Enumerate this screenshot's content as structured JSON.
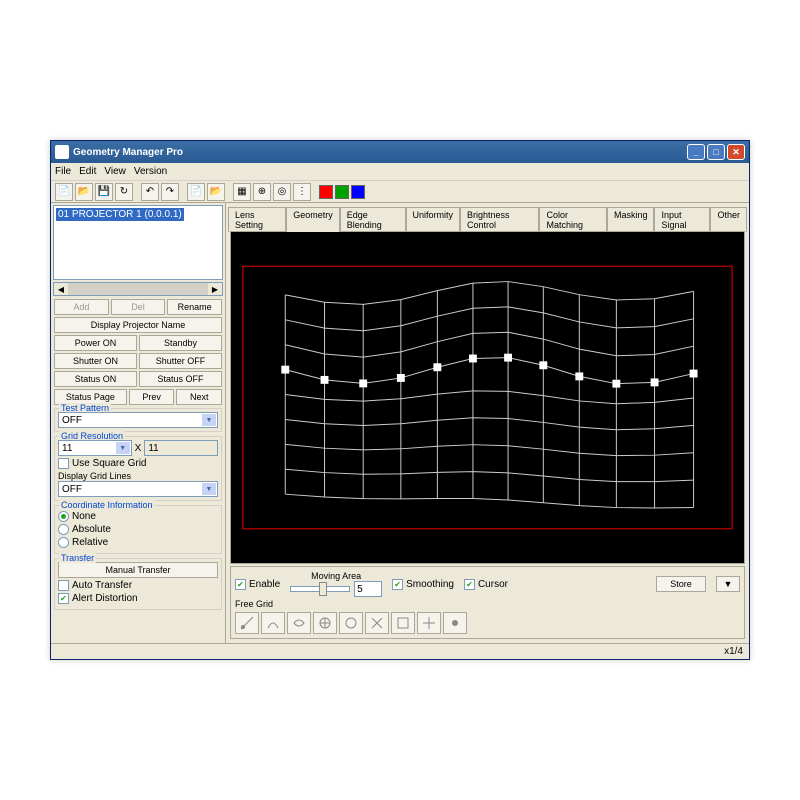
{
  "title": "Geometry Manager Pro",
  "menu": {
    "file": "File",
    "edit": "Edit",
    "view": "View",
    "version": "Version"
  },
  "swatches": [
    "#ff0000",
    "#00a000",
    "#0000ff"
  ],
  "projector": {
    "item": "01   PROJECTOR 1 (0.0.0.1)"
  },
  "proj_btns": {
    "add": "Add",
    "del": "Del",
    "rename": "Rename",
    "display_name": "Display Projector Name",
    "power_on": "Power ON",
    "standby": "Standby",
    "shutter_on": "Shutter ON",
    "shutter_off": "Shutter OFF",
    "status_on": "Status ON",
    "status_off": "Status OFF",
    "status_page": "Status Page",
    "prev": "Prev",
    "next": "Next"
  },
  "test_pattern": {
    "legend": "Test Pattern",
    "value": "OFF"
  },
  "grid_res": {
    "legend": "Grid Resolution",
    "x": "11",
    "y": "11",
    "times": "X",
    "use_square": "Use Square Grid",
    "dgl_label": "Display Grid Lines",
    "dgl_value": "OFF"
  },
  "coord": {
    "legend": "Coordinate Information",
    "none": "None",
    "abs": "Absolute",
    "rel": "Relative"
  },
  "transfer": {
    "legend": "Transfer",
    "manual": "Manual Transfer",
    "auto": "Auto Transfer",
    "alert": "Alert Distortion"
  },
  "tabs": [
    "Lens Setting",
    "Geometry",
    "Edge Blending",
    "Uniformity",
    "Brightness Control",
    "Color Matching",
    "Masking",
    "Input Signal",
    "Other"
  ],
  "active_tab": "Geometry",
  "bottom": {
    "enable": "Enable",
    "moving_area": "Moving Area",
    "moving_val": "5",
    "smoothing": "Smoothing",
    "cursor": "Cursor",
    "store": "Store",
    "arrow": "▼",
    "free_grid": "Free Grid"
  },
  "status": "x1/4"
}
